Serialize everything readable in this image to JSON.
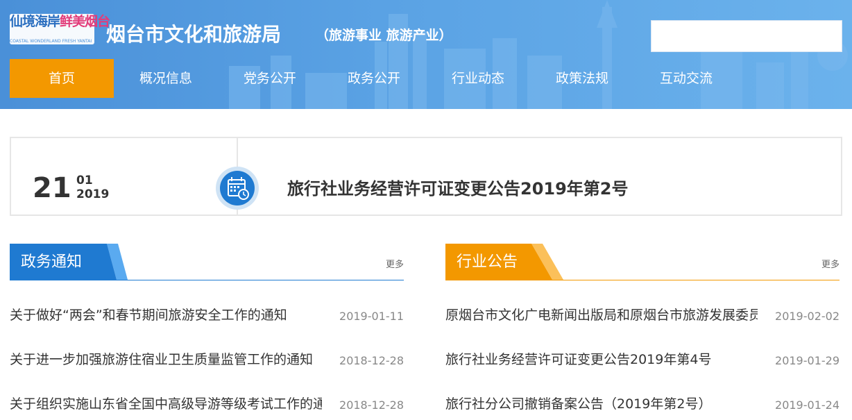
{
  "colors": {
    "header_bg": "#5aa2e4",
    "nav_active": "#f39800",
    "blue_accent": "#1f7ad1",
    "orange_accent": "#f39800"
  },
  "header": {
    "logo": {
      "main_a": "仙境海岸",
      "main_b": "鲜美烟台",
      "sub": "COASTAL WONDERLAND  FRESH YANTAI"
    },
    "site_title": "烟台市文化和旅游局",
    "site_subtitle": "（旅游事业 旅游产业）",
    "search": {
      "value": "",
      "placeholder": ""
    }
  },
  "nav": {
    "items": [
      {
        "label": "首页",
        "active": true
      },
      {
        "label": "概况信息"
      },
      {
        "label": "党务公开"
      },
      {
        "label": "政务公开"
      },
      {
        "label": "行业动态"
      },
      {
        "label": "政策法规"
      },
      {
        "label": "互动交流"
      }
    ]
  },
  "banner": {
    "day": "21",
    "month": "01",
    "year": "2019",
    "icon": "calendar-icon",
    "headline": "旅行社业务经营许可证变更公告2019年第2号"
  },
  "left_column": {
    "title": "政务通知",
    "more": "更多",
    "items": [
      {
        "title": "关于做好“两会”和春节期间旅游安全工作的通知",
        "date": "2019-01-11"
      },
      {
        "title": "关于进一步加强旅游住宿业卫生质量监管工作的通知",
        "date": "2018-12-28"
      },
      {
        "title": "关于组织实施山东省全国中高级导游等级考试工作的通知",
        "date": "2018-12-28"
      }
    ]
  },
  "right_column": {
    "title": "行业公告",
    "more": "更多",
    "items": [
      {
        "title": "原烟台市文化广电新闻出版局和原烟台市旅游发展委员会",
        "date": "2019-02-02"
      },
      {
        "title": "旅行社业务经营许可证变更公告2019年第4号",
        "date": "2019-01-29"
      },
      {
        "title": "旅行社分公司撤销备案公告（2019年第2号）",
        "date": "2019-01-24"
      }
    ]
  }
}
